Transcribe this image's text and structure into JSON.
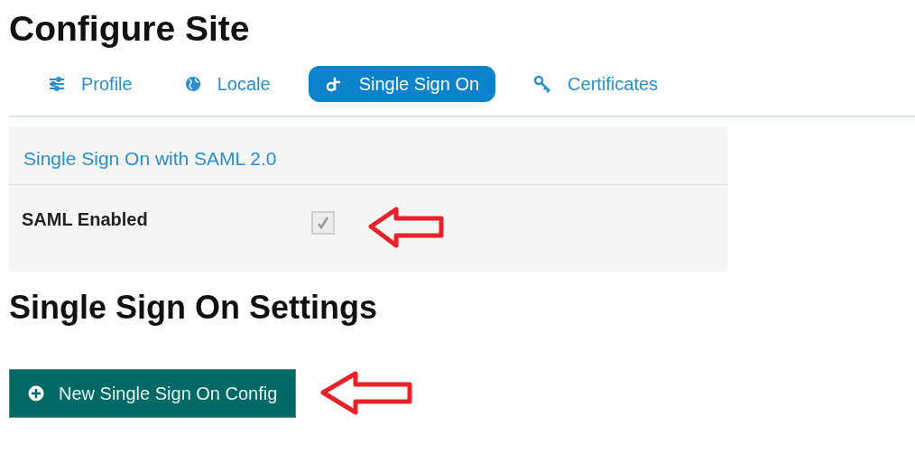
{
  "page_title": "Configure Site",
  "tabs": [
    {
      "label": "Profile",
      "selected": false
    },
    {
      "label": "Locale",
      "selected": false
    },
    {
      "label": "Single Sign On",
      "selected": true
    },
    {
      "label": "Certificates",
      "selected": false
    }
  ],
  "panel": {
    "title": "Single Sign On with SAML 2.0",
    "fields": [
      {
        "label": "SAML Enabled",
        "checked": true,
        "disabled": true
      }
    ]
  },
  "section_title": "Single Sign On Settings",
  "button": {
    "label": "New Single Sign On Config"
  }
}
